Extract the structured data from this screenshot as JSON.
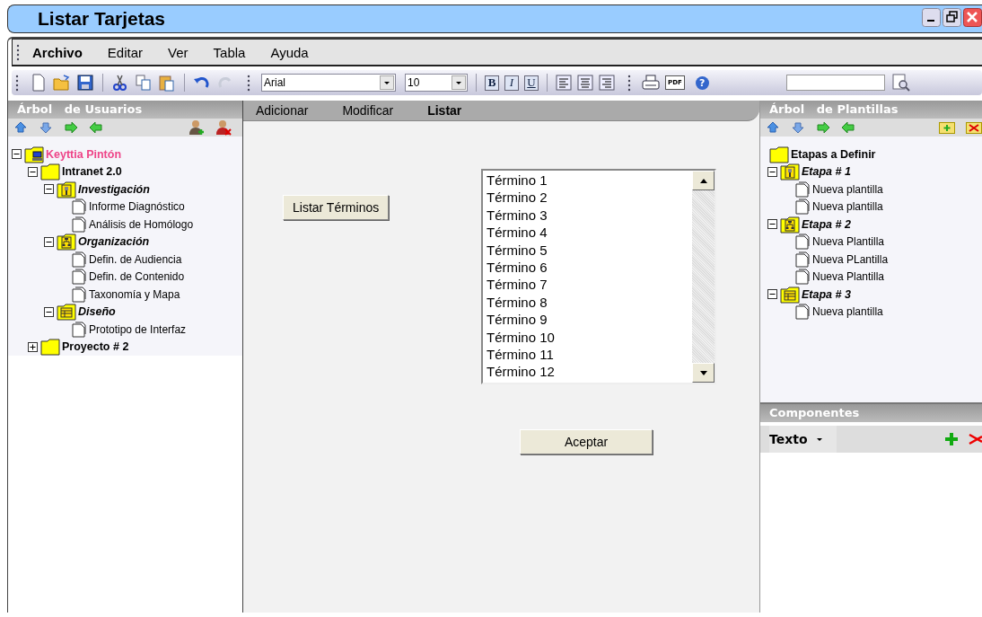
{
  "window": {
    "title": "Listar Tarjetas"
  },
  "menu": [
    {
      "label": "Archivo",
      "selected": true
    },
    {
      "label": "Editar",
      "selected": false
    },
    {
      "label": "Ver",
      "selected": false
    },
    {
      "label": "Tabla",
      "selected": false
    },
    {
      "label": "Ayuda",
      "selected": false
    }
  ],
  "toolbar": {
    "font_field": {
      "value": "Arial"
    },
    "size_field": {
      "value": "10"
    },
    "format_buttons": [
      "B",
      "I",
      "U"
    ],
    "pdf_button": "PDF",
    "help_button": "?"
  },
  "left_panel": {
    "title": "Árbol   de Usuarios",
    "tree": [
      {
        "kind": "user",
        "label": "Keyttia Pintón",
        "expanded": true,
        "children": [
          {
            "kind": "project",
            "label": "Intranet 2.0",
            "expanded": true,
            "children": [
              {
                "kind": "stage",
                "label": "Investigación",
                "expanded": true,
                "children": [
                  {
                    "kind": "document",
                    "label": "Informe Diagnóstico"
                  },
                  {
                    "kind": "document",
                    "label": "Análisis de Homólogo"
                  }
                ]
              },
              {
                "kind": "stage",
                "label": "Organización",
                "expanded": true,
                "children": [
                  {
                    "kind": "document",
                    "label": "Defin. de Audiencia"
                  },
                  {
                    "kind": "document",
                    "label": "Defin. de Contenido"
                  },
                  {
                    "kind": "document",
                    "label": "Taxonomía y Mapa"
                  }
                ]
              },
              {
                "kind": "stage",
                "label": "Diseño",
                "expanded": true,
                "children": [
                  {
                    "kind": "document",
                    "label": "Prototipo de Interfaz"
                  }
                ]
              }
            ]
          },
          {
            "kind": "project",
            "label": "Proyecto # 2",
            "expanded": false
          }
        ]
      }
    ]
  },
  "tabs": [
    {
      "label": "Adicionar",
      "selected": false
    },
    {
      "label": "Modificar",
      "selected": false
    },
    {
      "label": "Listar",
      "selected": true
    }
  ],
  "list_button": "Listar Términos",
  "terms": [
    "Término 1",
    "Término 2",
    "Término 3",
    "Término 4",
    "Término 5",
    "Término 6",
    "Término 7",
    "Término 8",
    "Término 9",
    "Término 10",
    "Término 11",
    "Término 12"
  ],
  "accept_button": "Aceptar",
  "right_panel": {
    "title": "Árbol   de Plantillas",
    "tree": [
      {
        "kind": "folder",
        "label": "Etapas a Definir"
      },
      {
        "kind": "stage",
        "label": "Etapa # 1",
        "expanded": true,
        "children": [
          {
            "kind": "document",
            "label": "Nueva plantilla"
          },
          {
            "kind": "document",
            "label": "Nueva plantilla"
          }
        ]
      },
      {
        "kind": "stage",
        "label": "Etapa # 2",
        "expanded": true,
        "children": [
          {
            "kind": "document",
            "label": "Nueva Plantilla"
          },
          {
            "kind": "document",
            "label": "Nueva PLantilla"
          },
          {
            "kind": "document",
            "label": "Nueva Plantilla"
          }
        ]
      },
      {
        "kind": "stage",
        "label": "Etapa # 3",
        "expanded": true,
        "children": [
          {
            "kind": "document",
            "label": "Nueva plantilla"
          }
        ]
      }
    ]
  },
  "components": {
    "title": "Componentes",
    "type_dropdown": {
      "value": "Texto"
    }
  }
}
